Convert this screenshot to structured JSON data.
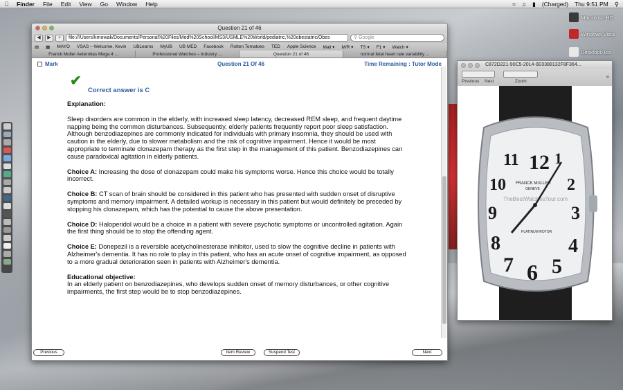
{
  "menubar": {
    "app": "Finder",
    "items": [
      "File",
      "Edit",
      "View",
      "Go",
      "Window",
      "Help"
    ],
    "battery": "(Charged)",
    "clock": "Thu 9:51 PM"
  },
  "desktop_icons": [
    {
      "label": "Macintosh HD",
      "color": "#3a3a3a"
    },
    {
      "label": "Windows Vista",
      "color": "#c0262a"
    },
    {
      "label": "Desktop0.ica",
      "color": "#e8e8e8"
    }
  ],
  "browser": {
    "window_title": "Question 21 of 46",
    "url": "file:///Users/krnowak/Documents/Personal%20Files/Med%20School/MS3/USMLE%20World/pediatric,%20obestatric/Obes",
    "search_placeholder": "Google",
    "bookmarks": [
      "MAYO",
      "VSAS – Welcome, Kevin",
      "UBLearns",
      "MyUB",
      "UB MED",
      "Facebook",
      "Rotten Tomatoes",
      "TED",
      "Apple Science",
      "Mail ▾",
      "M/R ▾",
      "TS ▾",
      "F1 ▾",
      "Watch ▾"
    ],
    "tabs": [
      "Franck Muller Aeternitas Mega 4 ...",
      "Professional Watches – Industry ...",
      "Question 21 of 46",
      "normal fetal heart rate variability ..."
    ],
    "active_tab": 2
  },
  "question": {
    "mark_label": "Mark",
    "number_label": "Question 21 Of 46",
    "mode_label": "Time Remaining : Tutor Mode",
    "correct_text": "Correct answer is C",
    "explanation_heading": "Explanation:",
    "explanation": "Sleep disorders are common in the elderly, with increased sleep latency, decreased REM sleep, and frequent daytime napping being the common disturbances.  Subsequently, elderly patients frequently report poor sleep satisfaction.  Although benzodiazepines are commonly indicated for individuals with primary insomnia, they should be used with caution in the elderly, due to slower metabolism and the risk of cognitive impairment.  Hence it would be most appropriate to terminate clonazepam therapy as the first step in the management of this patient. Benzodiazepines can cause paradoxical agitation in elderly patients.",
    "choices": [
      {
        "label": "Choice A:",
        "text": " Increasing the dose of clonazepam could make his symptoms worse.  Hence this choice would be totally incorrect."
      },
      {
        "label": "Choice B:",
        "text": " CT scan of brain should be considered in this patient who has presented with sudden onset of disruptive symptoms and memory impairment.  A detailed workup is necessary in this patient but would definitely be preceded by stopping his clonazepam, which has the potential to cause the above presentation."
      },
      {
        "label": "Choice D:",
        "text": " Haloperidol would be a choice in a patient with severe psychotic symptoms or uncontrolled agitation.  Again the first thing should be to stop the offending agent."
      },
      {
        "label": "Choice E:",
        "text": " Donepezil is a reversible acetycholinesterase inhibitor, used to slow the cognitive decline in patients with Alzheimer's dementia.  It has no role to play in this patient, who has an acute onset of cognitive impairment, as opposed to a more gradual deterioration seen in patients with Alzheimer's dementia."
      }
    ],
    "objective_heading": "Educational objective:",
    "objective": "In an elderly patient on benzodiazepines, who develops sudden onset of memory disturbances, or other cognitive impairments, the first step would be to stop benzodiazepines."
  },
  "buttons": {
    "previous": "Previous",
    "item_review": "Item Review",
    "suspend": "Suspend Test",
    "next": "Next"
  },
  "preview": {
    "title": "C872D221-90C5-2014-0E0388132F8F364...",
    "prev_label": "Previous",
    "next_label": "Next",
    "zoom_label": "Zoom",
    "watch_brand": "FRANCK MULLER",
    "watch_city": "GENEVE",
    "watch_model": "PLATINUM ROTOR",
    "watermark": "TheBestWatchesTour.com",
    "numerals": [
      "12",
      "1",
      "2",
      "3",
      "4",
      "5",
      "6",
      "7",
      "8",
      "9",
      "10",
      "11"
    ]
  },
  "colors": {
    "link_blue": "#2a5aa0",
    "check_green": "#2f8a1e"
  }
}
